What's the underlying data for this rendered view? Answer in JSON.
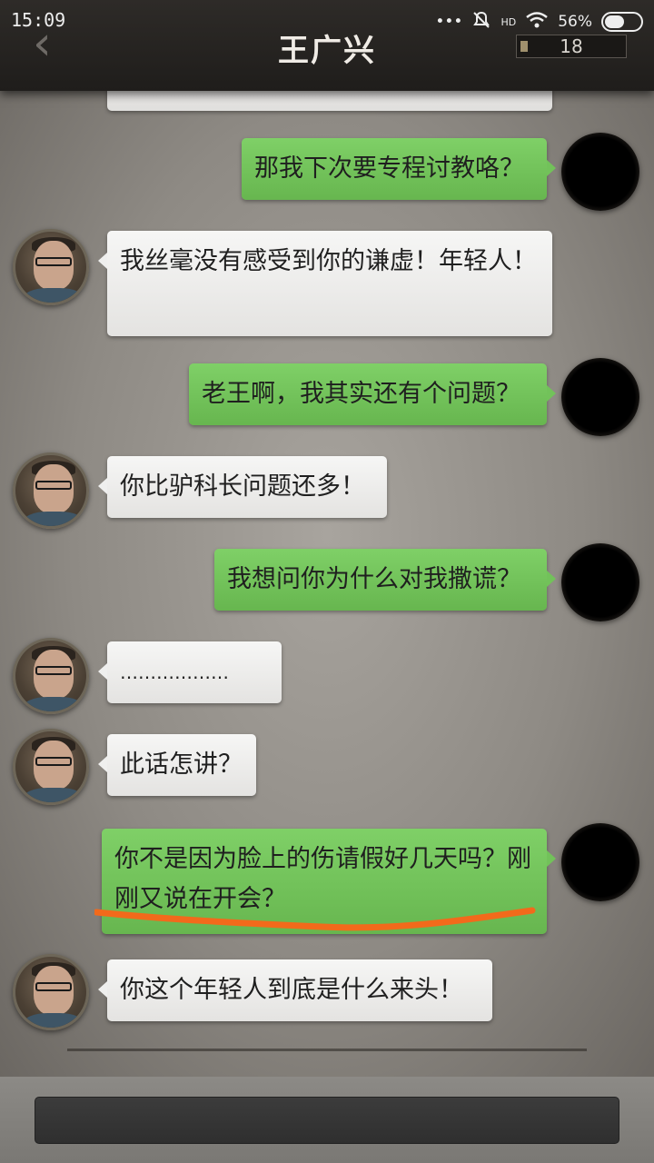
{
  "status_bar": {
    "time": "15:09",
    "network": "HD",
    "battery": "56%",
    "battery_fraction": 0.56
  },
  "header": {
    "title": "王广兴",
    "counter": "18"
  },
  "messages": [
    {
      "side": "right",
      "text": "那我下次要专程讨教咯？"
    },
    {
      "side": "left",
      "text": "我丝毫没有感受到你的谦虚！年轻人！"
    },
    {
      "side": "right",
      "text": "老王啊，我其实还有个问题？"
    },
    {
      "side": "left",
      "text": "你比驴科长问题还多！"
    },
    {
      "side": "right",
      "text": "我想问你为什么对我撒谎？"
    },
    {
      "side": "left",
      "text": "………………"
    },
    {
      "side": "left",
      "text": "此话怎讲？"
    },
    {
      "side": "right",
      "text": "你不是因为脸上的伤请假好几天吗？刚刚又说在开会？"
    },
    {
      "side": "left",
      "text": "你这个年轻人到底是什么来头！"
    }
  ],
  "colors": {
    "bubble_right": "#72c25a",
    "bubble_left": "#efefee",
    "annotation_underline": "#f26a1b"
  },
  "icons": {
    "back": "chevron-left-icon",
    "mute": "bell-off-icon",
    "wifi": "wifi-icon"
  }
}
